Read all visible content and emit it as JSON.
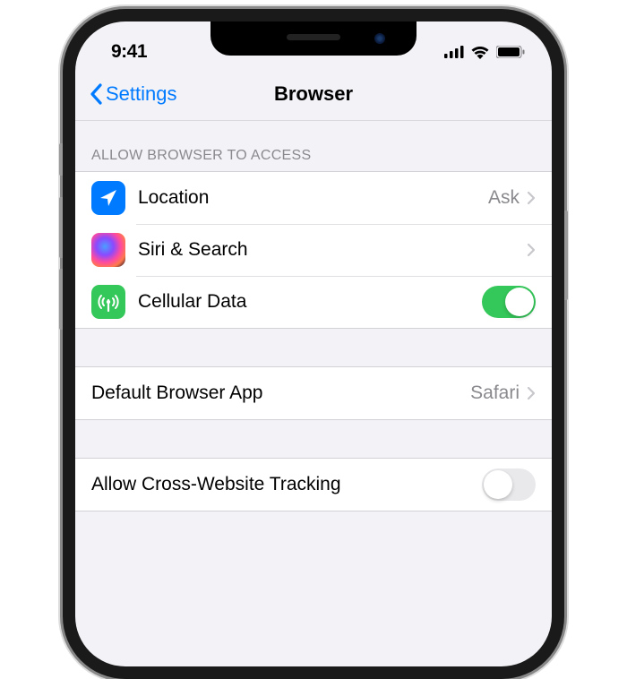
{
  "status": {
    "time": "9:41"
  },
  "nav": {
    "back_label": "Settings",
    "title": "Browser"
  },
  "sections": {
    "access": {
      "header": "Allow Browser to Access",
      "location": {
        "label": "Location",
        "value": "Ask"
      },
      "siri": {
        "label": "Siri & Search"
      },
      "cellular": {
        "label": "Cellular Data",
        "enabled": true
      }
    },
    "default": {
      "label": "Default Browser App",
      "value": "Safari"
    },
    "tracking": {
      "label": "Allow Cross-Website Tracking",
      "enabled": false
    }
  }
}
